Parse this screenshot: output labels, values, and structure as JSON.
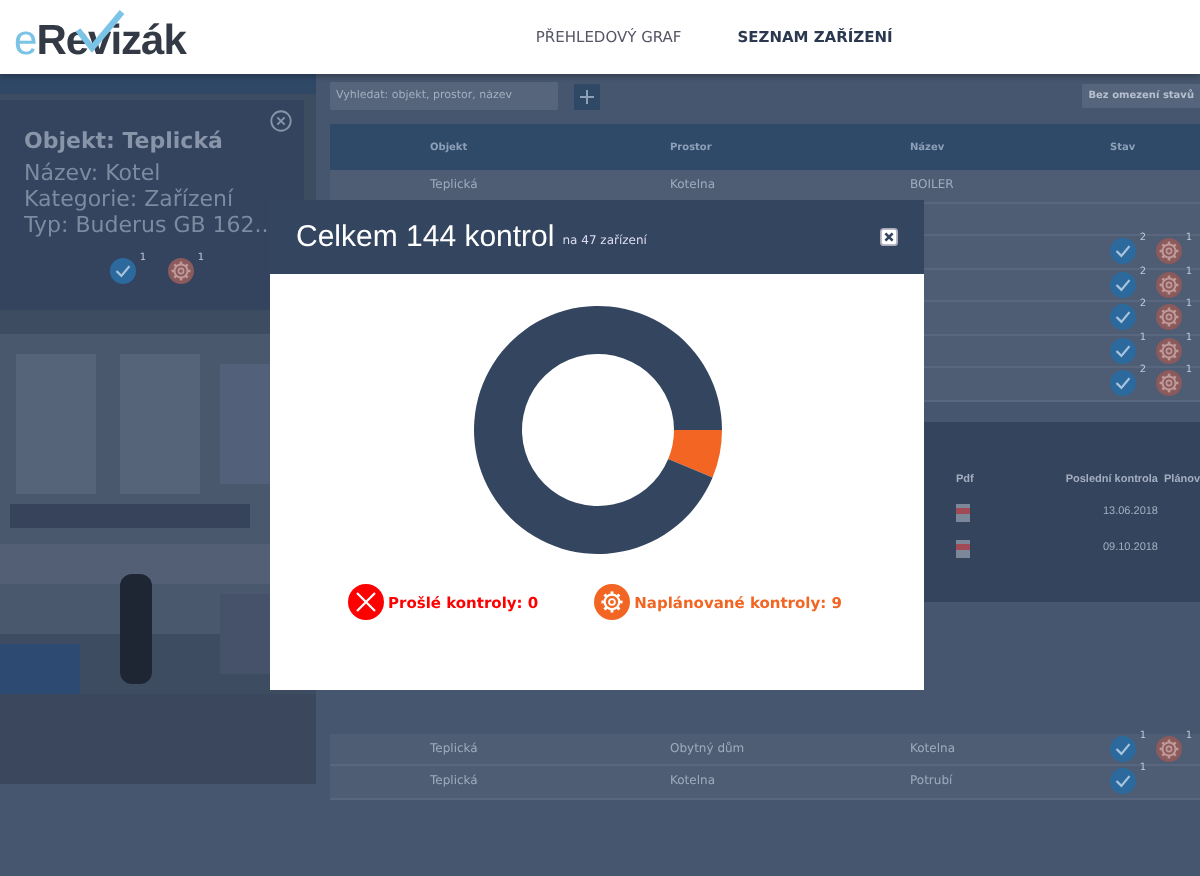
{
  "header": {
    "logo": {
      "prefix": "e",
      "name": "Revizák"
    },
    "nav": [
      {
        "label": "PŘEHLEDOVÝ GRAF",
        "selected": false
      },
      {
        "label": "SEZNAM ZAŘÍZENÍ",
        "selected": true
      }
    ]
  },
  "info_popup": {
    "title": "Objekt: Teplická",
    "lines": [
      "Název: Kotel",
      "Kategorie: Zařízení",
      "Typ: Buderus GB 162.."
    ],
    "badges": [
      {
        "kind": "check",
        "count": "1"
      },
      {
        "kind": "gear",
        "count": "1"
      }
    ]
  },
  "toolbar": {
    "search": {
      "placeholder": "Vyhledat: objekt, prostor, název"
    },
    "filter": "Bez omezení stavů"
  },
  "table": {
    "columns": [
      "Objekt",
      "Prostor",
      "Název",
      "Stav"
    ],
    "rows": [
      {
        "cells": [
          "Teplická",
          "Kotelna",
          "BOILER"
        ],
        "badges": []
      },
      {
        "cells": [],
        "badges": []
      },
      {
        "cells": [],
        "badges": [
          {
            "kind": "check",
            "count": "2"
          },
          {
            "kind": "gear",
            "count": "1"
          }
        ]
      },
      {
        "cells": [],
        "badges": [
          {
            "kind": "check",
            "count": "2"
          },
          {
            "kind": "gear",
            "count": "1"
          }
        ]
      },
      {
        "cells": [],
        "badges": [
          {
            "kind": "check",
            "count": "2"
          },
          {
            "kind": "gear",
            "count": "1"
          }
        ]
      },
      {
        "cells": [],
        "badges": [
          {
            "kind": "check",
            "count": "1"
          },
          {
            "kind": "gear",
            "count": "1"
          }
        ]
      },
      {
        "cells": [],
        "badges": [
          {
            "kind": "check",
            "count": "2"
          },
          {
            "kind": "gear",
            "count": "1"
          }
        ]
      }
    ]
  },
  "detail": {
    "columns": [
      "Pdf",
      "Poslední kontrola",
      "Plánov"
    ],
    "rows": [
      {
        "date": "13.06.2018"
      },
      {
        "date": "09.10.2018"
      }
    ]
  },
  "lower_table": {
    "rows": [
      {
        "cells": [
          "Teplická",
          "Obytný dům",
          "Kotelna"
        ],
        "badges": [
          {
            "kind": "check",
            "count": "1"
          },
          {
            "kind": "gear",
            "count": "1"
          }
        ]
      },
      {
        "cells": [
          "Teplická",
          "Kotelna",
          "Potrubí"
        ],
        "badges": [
          {
            "kind": "check",
            "count": "1"
          }
        ]
      }
    ]
  },
  "modal": {
    "title": "Celkem 144 kontrol",
    "subtitle": "na 47 zařízení",
    "chart_data": {
      "type": "donut",
      "values": [
        6.25,
        93.75
      ],
      "colors": [
        "#f26522",
        "#344560"
      ]
    },
    "legend": [
      {
        "kind": "expired",
        "label": "Prošlé kontroly: 0",
        "color": "#ff0000"
      },
      {
        "kind": "planned",
        "label": "Naplánované kontroly: 9",
        "color": "#f26522"
      }
    ]
  }
}
